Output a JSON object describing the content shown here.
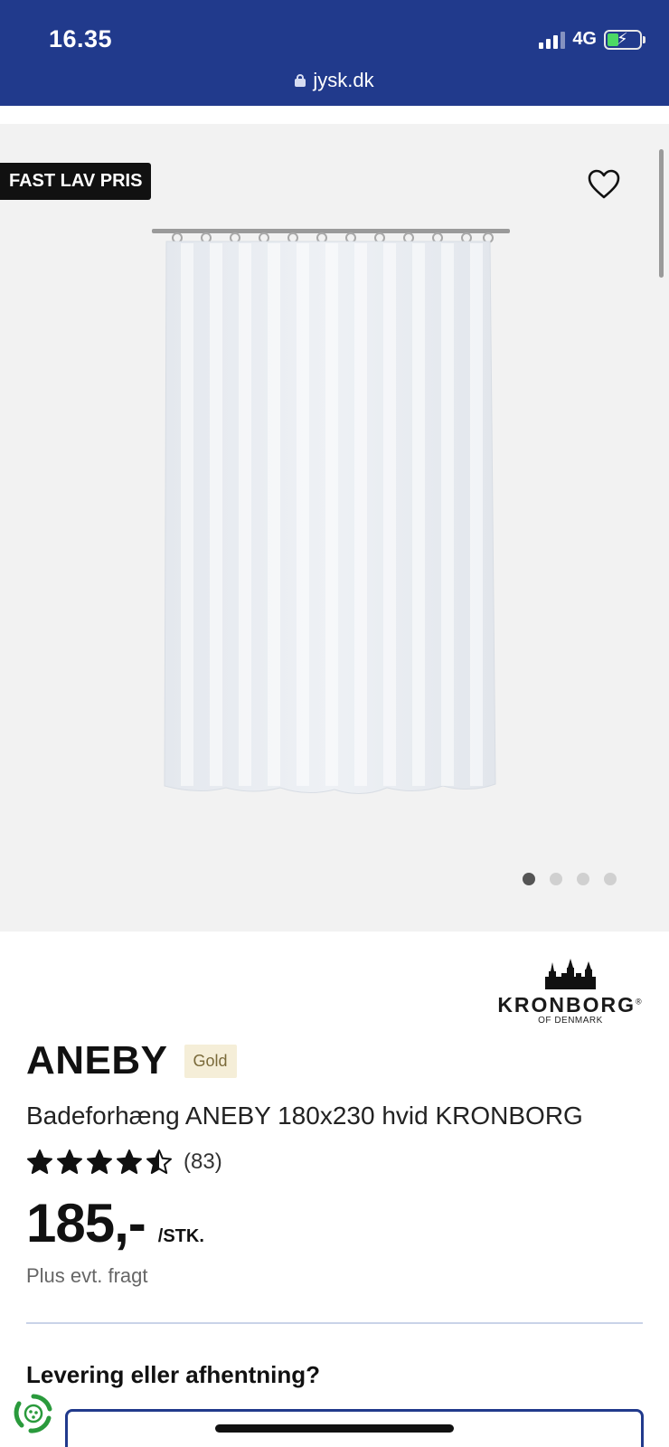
{
  "status_bar": {
    "time": "16.35",
    "network": "4G"
  },
  "browser": {
    "url": "jysk.dk"
  },
  "gallery": {
    "badge": "FAST LAV PRIS",
    "image_count": 4,
    "active_image": 1
  },
  "brand": {
    "name": "KRONBORG",
    "registered_mark": "®",
    "subline": "OF DENMARK"
  },
  "product": {
    "title": "ANEBY",
    "tier": "Gold",
    "description": "Badeforhæng ANEBY 180x230 hvid KRONBORG",
    "rating": 4.5,
    "rating_max": 5,
    "review_count": "(83)",
    "price": "185,-",
    "unit": "/STK.",
    "shipping_note": "Plus evt. fragt"
  },
  "delivery": {
    "heading": "Levering eller afhentning?"
  },
  "colors": {
    "header_blue": "#213a8c",
    "badge_black": "#111111",
    "gallery_bg": "#f2f2f2",
    "tier_bg": "#f5eed8",
    "recycle_green": "#2a9a3c"
  }
}
